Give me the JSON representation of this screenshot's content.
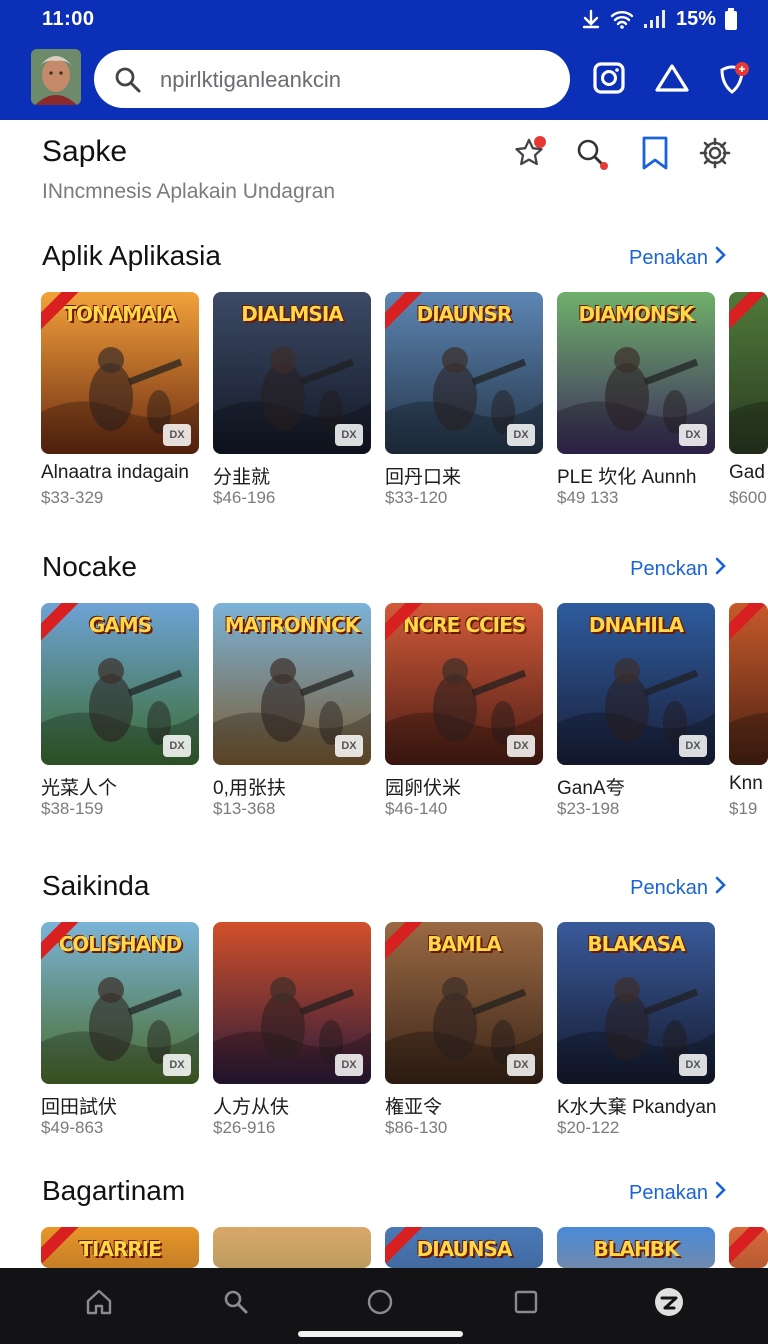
{
  "status": {
    "time": "11:00",
    "battery": "15%"
  },
  "search": {
    "text": "npirlktiganleankcin"
  },
  "header": {
    "title": "Sapke",
    "subtitle": "INncmnesis Aplakain Undagran"
  },
  "sections": [
    {
      "title": "Aplik Aplikasia",
      "link": "Penakan",
      "items": [
        {
          "name": "Alnaatra indagain",
          "price": "$33-329",
          "art": "TONAMAIA",
          "colors": [
            "#f3a23a",
            "#6b2a12"
          ]
        },
        {
          "name": "分韭就",
          "price": "$46-196",
          "art": "DIALMSIA",
          "colors": [
            "#3d4a66",
            "#121826"
          ]
        },
        {
          "name": "回丹口来",
          "price": "$33-120",
          "art": "DIAUNSR",
          "colors": [
            "#5d86b4",
            "#243447"
          ]
        },
        {
          "name": "PLE 坎化 Aunnh",
          "price": "$49 133",
          "art": "DIAMONSK",
          "colors": [
            "#6fb06a",
            "#3b2a5c"
          ]
        },
        {
          "name": "Gad",
          "price": "$600",
          "art": "",
          "colors": [
            "#4f7a3a",
            "#2b3a22"
          ]
        }
      ]
    },
    {
      "title": "Nocake",
      "link": "Penckan",
      "items": [
        {
          "name": "光菜人个",
          "price": "$38-159",
          "art": "GAMS",
          "colors": [
            "#6ea3d6",
            "#3a6b2f"
          ]
        },
        {
          "name": "0,用张扶",
          "price": "$13-368",
          "art": "MATRONNCK",
          "colors": [
            "#7bb3d9",
            "#7a5a30"
          ]
        },
        {
          "name": "园卵伏米",
          "price": "$46-140",
          "art": "NCRE CCIES",
          "colors": [
            "#d25a3a",
            "#4a1d14"
          ]
        },
        {
          "name": "GanA夸",
          "price": "$23-198",
          "art": "DNAHILA",
          "colors": [
            "#2e5c9e",
            "#1a1f3a"
          ]
        },
        {
          "name": "Knn",
          "price": "$19",
          "art": "",
          "colors": [
            "#c85a2a",
            "#4a2214"
          ]
        }
      ]
    },
    {
      "title": "Saikinda",
      "link": "Penckan",
      "items": [
        {
          "name": "回田試伏",
          "price": "$49-863",
          "art": "COLISHAND",
          "colors": [
            "#7ab4d8",
            "#4a6b2a"
          ]
        },
        {
          "name": "人方从伕",
          "price": "$26-916",
          "art": "",
          "colors": [
            "#d2502a",
            "#2a1a3a"
          ]
        },
        {
          "name": "権亚令",
          "price": "$86-130",
          "art": "BAMLA",
          "colors": [
            "#9a6a44",
            "#3a2418"
          ]
        },
        {
          "name": "K水大棄 Pkandyan",
          "price": "$20-122",
          "art": "BLAKASA",
          "colors": [
            "#3a5a9a",
            "#141a2e"
          ]
        }
      ]
    },
    {
      "title": "Bagartinam",
      "link": "Penakan",
      "items": [
        {
          "art": "TIARRIE",
          "colors": [
            "#e8962a",
            "#5a3a1a"
          ]
        },
        {
          "art": "",
          "colors": [
            "#d8a86a",
            "#6a7a3a"
          ]
        },
        {
          "art": "DIAUNSA",
          "colors": [
            "#4a7ab8",
            "#2a3a5a"
          ]
        },
        {
          "art": "BLAHBK",
          "colors": [
            "#4a8ad8",
            "#e08a2a"
          ]
        },
        {
          "art": "",
          "colors": [
            "#d86a3a",
            "#5a2a1a"
          ]
        }
      ]
    }
  ]
}
